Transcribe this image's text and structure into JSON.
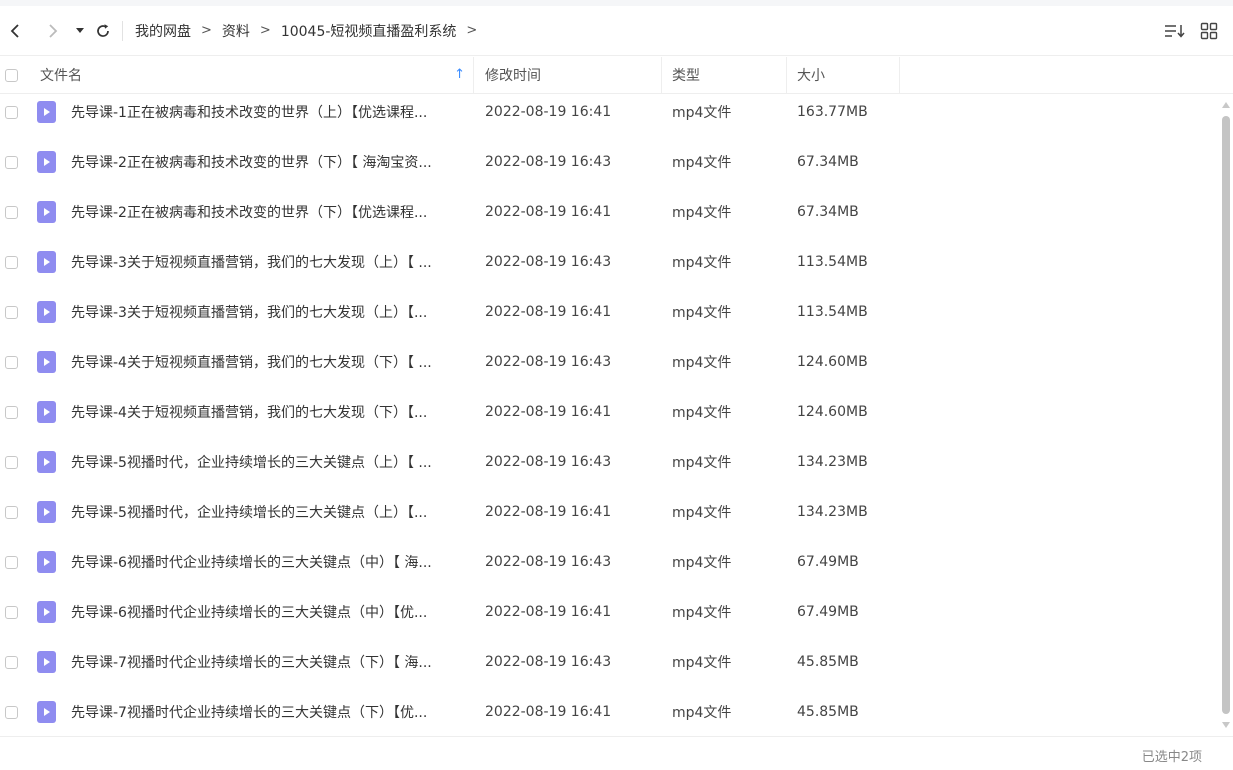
{
  "toolbar": {
    "back_icon": "chevron-left-icon",
    "forward_icon": "chevron-right-icon",
    "history_icon": "caret-down-icon",
    "refresh_icon": "refresh-icon",
    "breadcrumb": [
      "我的网盘",
      "资料",
      "10045-短视频直播盈利系统"
    ],
    "crumb_sep": ">",
    "sort_icon": "sort-list-icon",
    "view_icon": "grid-view-icon"
  },
  "header": {
    "name": "文件名",
    "time": "修改时间",
    "type": "类型",
    "size": "大小",
    "sort_arrow": "↑"
  },
  "rows": [
    {
      "name": "先导课-1正在被病毒和技术改变的世界（上）【优选课程...",
      "time": "2022-08-19 16:41",
      "type": "mp4文件",
      "size": "163.77MB"
    },
    {
      "name": "先导课-2正在被病毒和技术改变的世界（下）【 海淘宝资...",
      "time": "2022-08-19 16:43",
      "type": "mp4文件",
      "size": "67.34MB"
    },
    {
      "name": "先导课-2正在被病毒和技术改变的世界（下）【优选课程...",
      "time": "2022-08-19 16:41",
      "type": "mp4文件",
      "size": "67.34MB"
    },
    {
      "name": "先导课-3关于短视频直播营销，我们的七大发现（上）【 ...",
      "time": "2022-08-19 16:43",
      "type": "mp4文件",
      "size": "113.54MB"
    },
    {
      "name": "先导课-3关于短视频直播营销，我们的七大发现（上）【...",
      "time": "2022-08-19 16:41",
      "type": "mp4文件",
      "size": "113.54MB"
    },
    {
      "name": "先导课-4关于短视频直播营销，我们的七大发现（下）【 ...",
      "time": "2022-08-19 16:43",
      "type": "mp4文件",
      "size": "124.60MB"
    },
    {
      "name": "先导课-4关于短视频直播营销，我们的七大发现（下）【...",
      "time": "2022-08-19 16:41",
      "type": "mp4文件",
      "size": "124.60MB"
    },
    {
      "name": "先导课-5视播时代，企业持续增长的三大关键点（上）【 ...",
      "time": "2022-08-19 16:43",
      "type": "mp4文件",
      "size": "134.23MB"
    },
    {
      "name": "先导课-5视播时代，企业持续增长的三大关键点（上）【...",
      "time": "2022-08-19 16:41",
      "type": "mp4文件",
      "size": "134.23MB"
    },
    {
      "name": "先导课-6视播时代企业持续增长的三大关键点（中）【 海...",
      "time": "2022-08-19 16:43",
      "type": "mp4文件",
      "size": "67.49MB"
    },
    {
      "name": "先导课-6视播时代企业持续增长的三大关键点（中）【优...",
      "time": "2022-08-19 16:41",
      "type": "mp4文件",
      "size": "67.49MB"
    },
    {
      "name": "先导课-7视播时代企业持续增长的三大关键点（下）【 海...",
      "time": "2022-08-19 16:43",
      "type": "mp4文件",
      "size": "45.85MB"
    },
    {
      "name": "先导课-7视播时代企业持续增长的三大关键点（下）【优...",
      "time": "2022-08-19 16:41",
      "type": "mp4文件",
      "size": "45.85MB"
    }
  ],
  "row_icon": "video-file-icon",
  "footer": {
    "status": "已选中2项"
  },
  "colors": {
    "accent": "#3b8cff",
    "file_icon": "#8f8cf0",
    "border": "#eeeeee"
  }
}
